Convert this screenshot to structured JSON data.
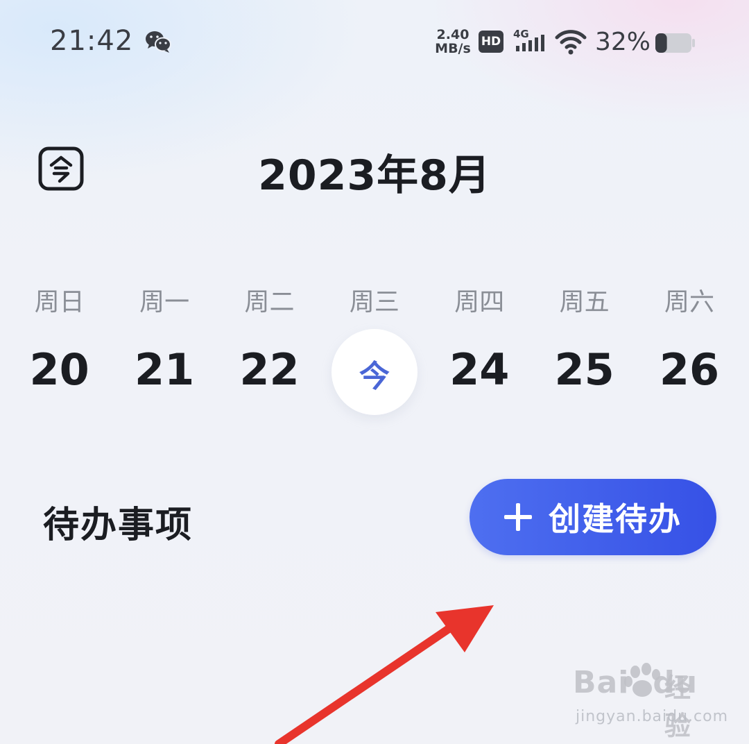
{
  "status_bar": {
    "time": "21:42",
    "net_speed_value": "2.40",
    "net_speed_unit": "MB/s",
    "hd_badge": "HD",
    "network_type": "4G",
    "battery_percent": "32%",
    "battery_level": 0.32
  },
  "header": {
    "today_icon": "today-calendar-icon",
    "month_title": "2023年8月"
  },
  "week": {
    "days": [
      {
        "name": "周日",
        "num": "20"
      },
      {
        "name": "周一",
        "num": "21"
      },
      {
        "name": "周二",
        "num": "22"
      },
      {
        "name": "周三",
        "num": "今"
      },
      {
        "name": "周四",
        "num": "24"
      },
      {
        "name": "周五",
        "num": "25"
      },
      {
        "name": "周六",
        "num": "26"
      }
    ],
    "selected_index": 3
  },
  "todo": {
    "title": "待办事项",
    "create_label": "创建待办"
  },
  "watermark": {
    "logo_text_a": "Bai",
    "logo_text_b": "du",
    "logo_text_c": "经验",
    "url": "jingyan.baidu.com"
  },
  "colors": {
    "accent": "#3d5ae8",
    "today_text": "#4a66d6",
    "annotation_arrow": "#e8342c"
  }
}
